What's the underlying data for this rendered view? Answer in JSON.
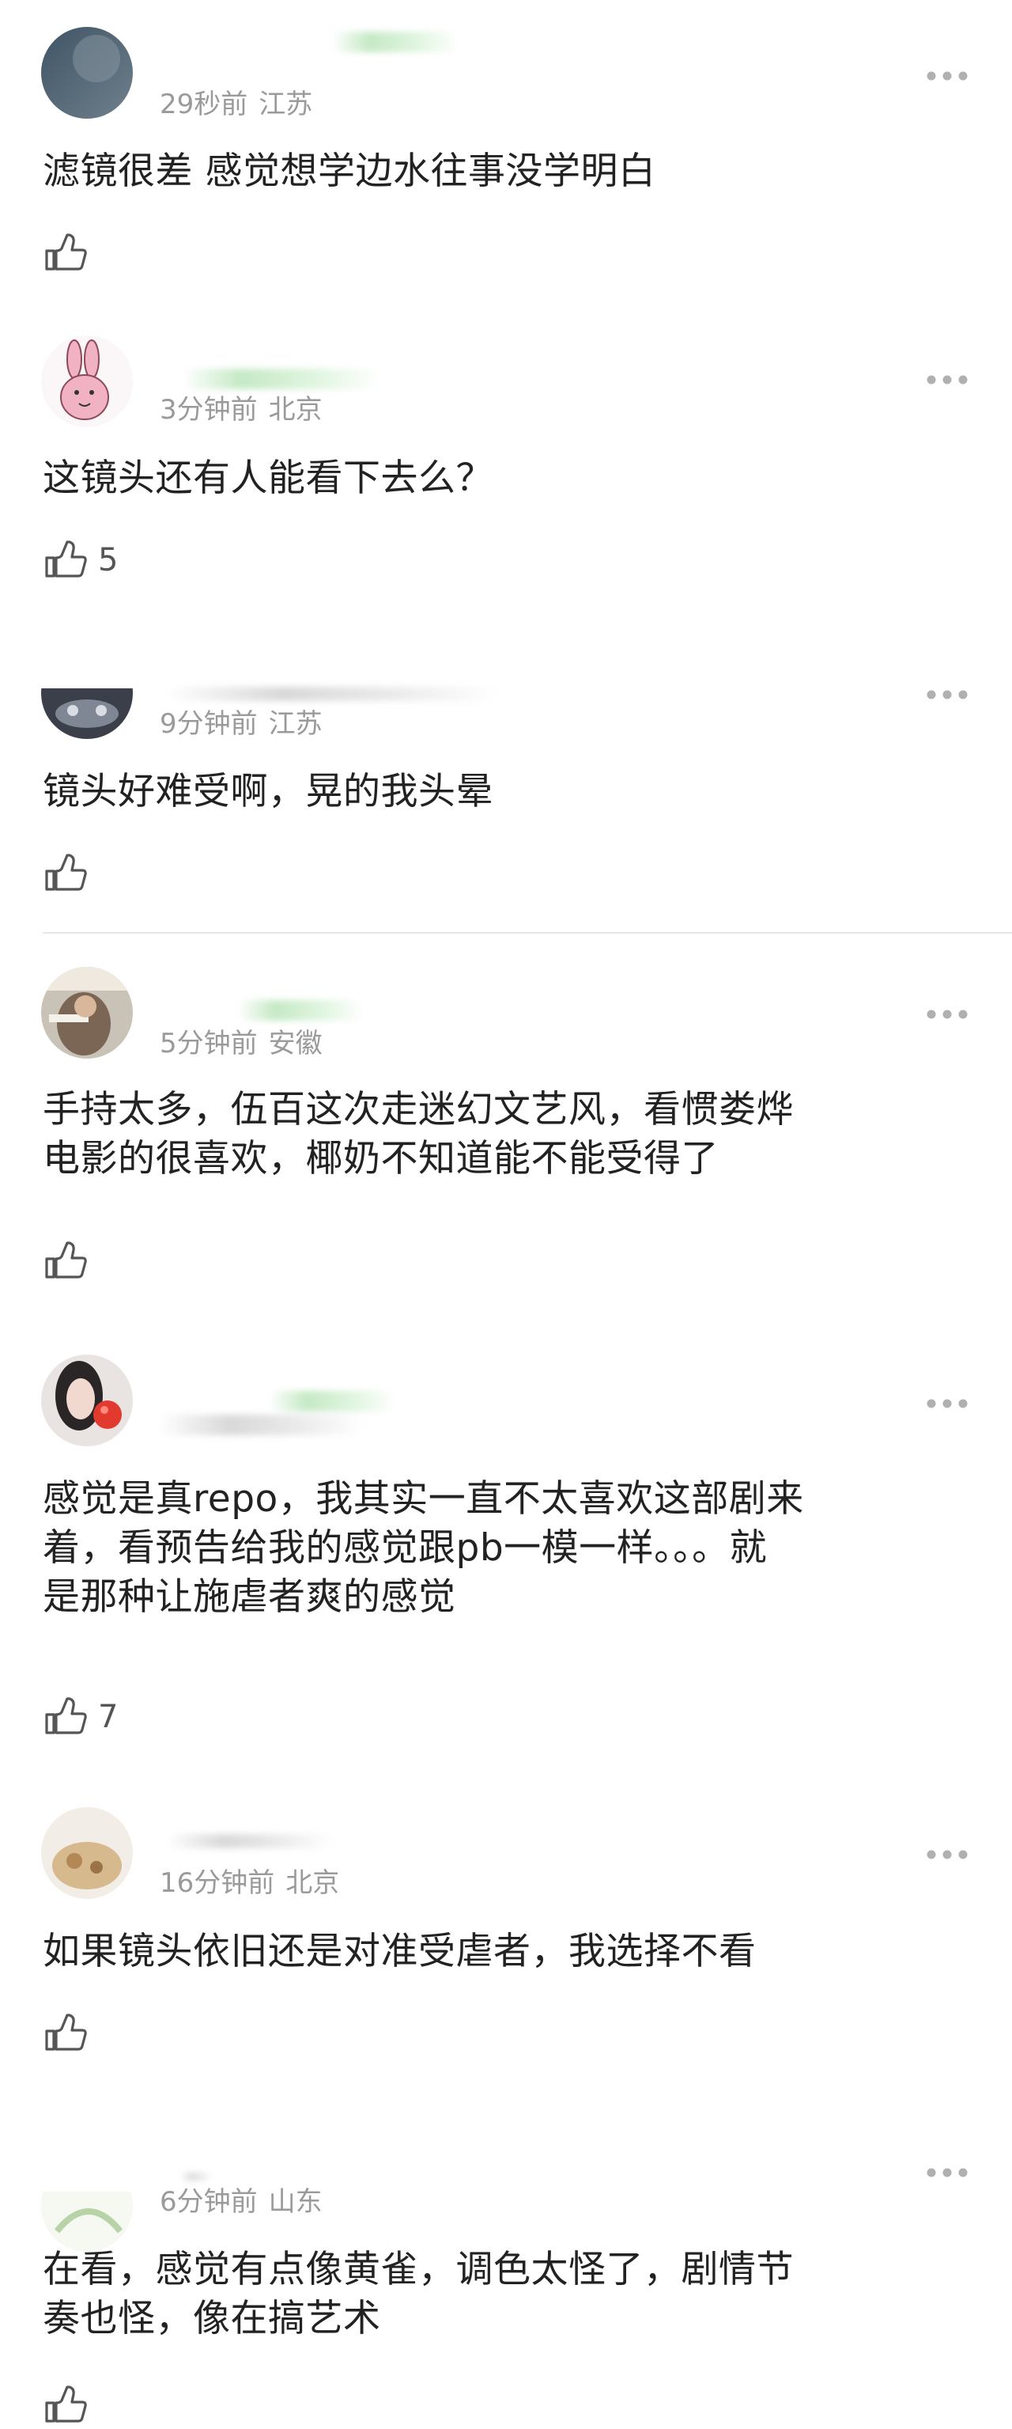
{
  "comments": [
    {
      "time": "29秒前",
      "location": "江苏",
      "text": "滤镜很差 感觉想学边水往事没学明白",
      "likes": ""
    },
    {
      "time": "3分钟前",
      "location": "北京",
      "text": "这镜头还有人能看下去么？",
      "likes": "5"
    },
    {
      "time": "9分钟前",
      "location": "江苏",
      "text": "镜头好难受啊，晃的我头晕",
      "likes": ""
    },
    {
      "time": "5分钟前",
      "location": "安徽",
      "text": "手持太多，伍百这次走迷幻文艺风，看惯娄烨\n电影的很喜欢，椰奶不知道能不能受得了",
      "likes": ""
    },
    {
      "time": "",
      "location": "",
      "text": "感觉是真repo，我其实一直不太喜欢这部剧来\n着，看预告给我的感觉跟pb一模一样。。。就\n是那种让施虐者爽的感觉",
      "likes": "7"
    },
    {
      "time": "16分钟前",
      "location": "北京",
      "text": "如果镜头依旧还是对准受虐者，我选择不看",
      "likes": ""
    },
    {
      "time": "6分钟前",
      "location": "山东",
      "text": "在看，感觉有点像黄雀，调色太怪了，剧情节\n奏也怪，像在搞艺术",
      "likes": ""
    }
  ],
  "icons": {
    "like": "thumbs-up-icon",
    "more": "more-dots-icon"
  },
  "colors": {
    "meta_text": "#9a9a9a",
    "body_text": "#222222",
    "icon": "#555555"
  }
}
